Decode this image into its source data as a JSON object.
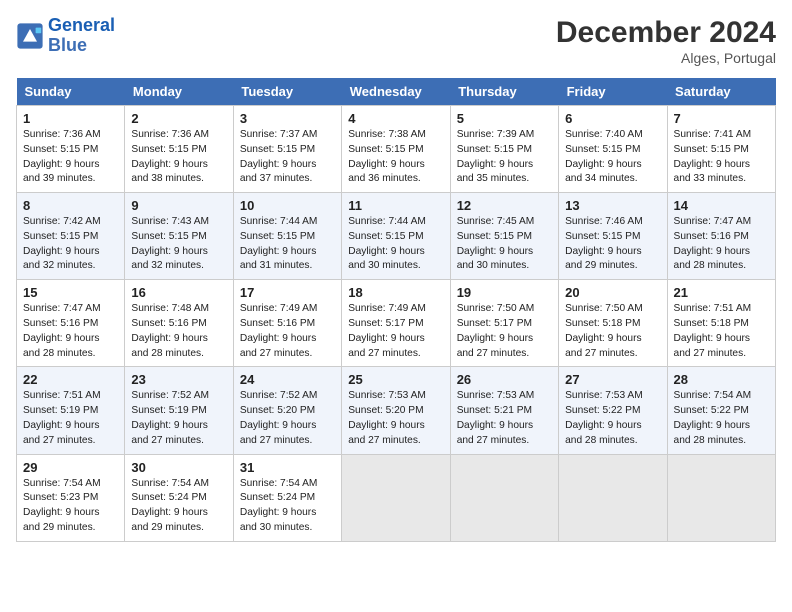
{
  "logo": {
    "line1": "General",
    "line2": "Blue"
  },
  "title": "December 2024",
  "location": "Alges, Portugal",
  "days_of_week": [
    "Sunday",
    "Monday",
    "Tuesday",
    "Wednesday",
    "Thursday",
    "Friday",
    "Saturday"
  ],
  "weeks": [
    [
      {
        "day": "1",
        "info": "Sunrise: 7:36 AM\nSunset: 5:15 PM\nDaylight: 9 hours\nand 39 minutes."
      },
      {
        "day": "2",
        "info": "Sunrise: 7:36 AM\nSunset: 5:15 PM\nDaylight: 9 hours\nand 38 minutes."
      },
      {
        "day": "3",
        "info": "Sunrise: 7:37 AM\nSunset: 5:15 PM\nDaylight: 9 hours\nand 37 minutes."
      },
      {
        "day": "4",
        "info": "Sunrise: 7:38 AM\nSunset: 5:15 PM\nDaylight: 9 hours\nand 36 minutes."
      },
      {
        "day": "5",
        "info": "Sunrise: 7:39 AM\nSunset: 5:15 PM\nDaylight: 9 hours\nand 35 minutes."
      },
      {
        "day": "6",
        "info": "Sunrise: 7:40 AM\nSunset: 5:15 PM\nDaylight: 9 hours\nand 34 minutes."
      },
      {
        "day": "7",
        "info": "Sunrise: 7:41 AM\nSunset: 5:15 PM\nDaylight: 9 hours\nand 33 minutes."
      }
    ],
    [
      {
        "day": "8",
        "info": "Sunrise: 7:42 AM\nSunset: 5:15 PM\nDaylight: 9 hours\nand 32 minutes."
      },
      {
        "day": "9",
        "info": "Sunrise: 7:43 AM\nSunset: 5:15 PM\nDaylight: 9 hours\nand 32 minutes."
      },
      {
        "day": "10",
        "info": "Sunrise: 7:44 AM\nSunset: 5:15 PM\nDaylight: 9 hours\nand 31 minutes."
      },
      {
        "day": "11",
        "info": "Sunrise: 7:44 AM\nSunset: 5:15 PM\nDaylight: 9 hours\nand 30 minutes."
      },
      {
        "day": "12",
        "info": "Sunrise: 7:45 AM\nSunset: 5:15 PM\nDaylight: 9 hours\nand 30 minutes."
      },
      {
        "day": "13",
        "info": "Sunrise: 7:46 AM\nSunset: 5:15 PM\nDaylight: 9 hours\nand 29 minutes."
      },
      {
        "day": "14",
        "info": "Sunrise: 7:47 AM\nSunset: 5:16 PM\nDaylight: 9 hours\nand 28 minutes."
      }
    ],
    [
      {
        "day": "15",
        "info": "Sunrise: 7:47 AM\nSunset: 5:16 PM\nDaylight: 9 hours\nand 28 minutes."
      },
      {
        "day": "16",
        "info": "Sunrise: 7:48 AM\nSunset: 5:16 PM\nDaylight: 9 hours\nand 28 minutes."
      },
      {
        "day": "17",
        "info": "Sunrise: 7:49 AM\nSunset: 5:16 PM\nDaylight: 9 hours\nand 27 minutes."
      },
      {
        "day": "18",
        "info": "Sunrise: 7:49 AM\nSunset: 5:17 PM\nDaylight: 9 hours\nand 27 minutes."
      },
      {
        "day": "19",
        "info": "Sunrise: 7:50 AM\nSunset: 5:17 PM\nDaylight: 9 hours\nand 27 minutes."
      },
      {
        "day": "20",
        "info": "Sunrise: 7:50 AM\nSunset: 5:18 PM\nDaylight: 9 hours\nand 27 minutes."
      },
      {
        "day": "21",
        "info": "Sunrise: 7:51 AM\nSunset: 5:18 PM\nDaylight: 9 hours\nand 27 minutes."
      }
    ],
    [
      {
        "day": "22",
        "info": "Sunrise: 7:51 AM\nSunset: 5:19 PM\nDaylight: 9 hours\nand 27 minutes."
      },
      {
        "day": "23",
        "info": "Sunrise: 7:52 AM\nSunset: 5:19 PM\nDaylight: 9 hours\nand 27 minutes."
      },
      {
        "day": "24",
        "info": "Sunrise: 7:52 AM\nSunset: 5:20 PM\nDaylight: 9 hours\nand 27 minutes."
      },
      {
        "day": "25",
        "info": "Sunrise: 7:53 AM\nSunset: 5:20 PM\nDaylight: 9 hours\nand 27 minutes."
      },
      {
        "day": "26",
        "info": "Sunrise: 7:53 AM\nSunset: 5:21 PM\nDaylight: 9 hours\nand 27 minutes."
      },
      {
        "day": "27",
        "info": "Sunrise: 7:53 AM\nSunset: 5:22 PM\nDaylight: 9 hours\nand 28 minutes."
      },
      {
        "day": "28",
        "info": "Sunrise: 7:54 AM\nSunset: 5:22 PM\nDaylight: 9 hours\nand 28 minutes."
      }
    ],
    [
      {
        "day": "29",
        "info": "Sunrise: 7:54 AM\nSunset: 5:23 PM\nDaylight: 9 hours\nand 29 minutes."
      },
      {
        "day": "30",
        "info": "Sunrise: 7:54 AM\nSunset: 5:24 PM\nDaylight: 9 hours\nand 29 minutes."
      },
      {
        "day": "31",
        "info": "Sunrise: 7:54 AM\nSunset: 5:24 PM\nDaylight: 9 hours\nand 30 minutes."
      },
      {
        "day": "",
        "info": ""
      },
      {
        "day": "",
        "info": ""
      },
      {
        "day": "",
        "info": ""
      },
      {
        "day": "",
        "info": ""
      }
    ]
  ]
}
